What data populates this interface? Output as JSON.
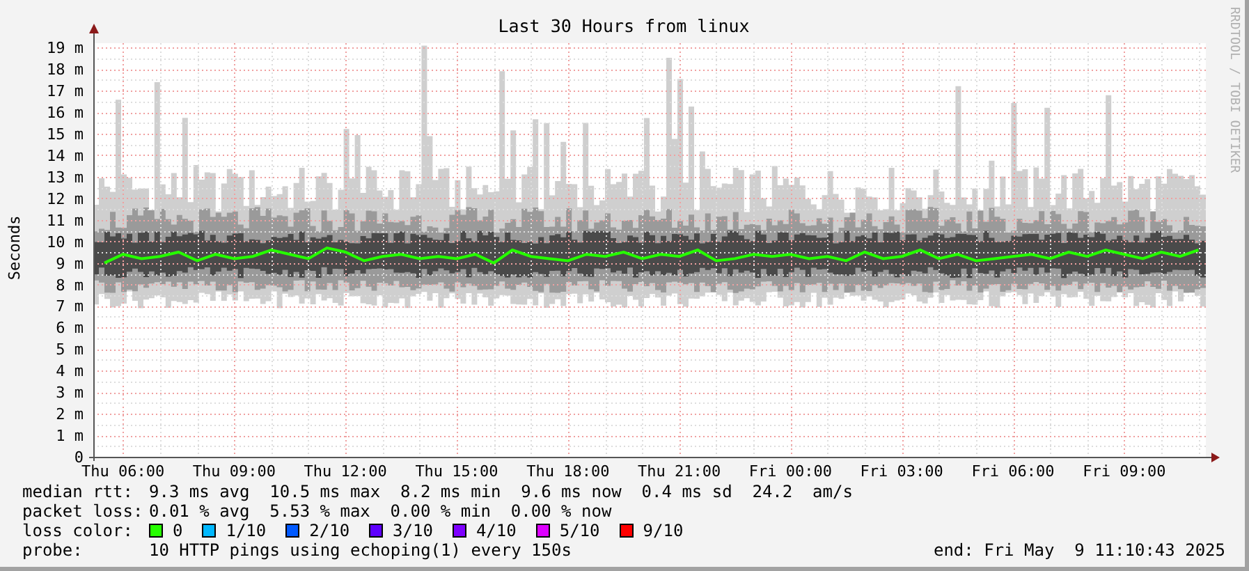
{
  "graph": {
    "credit": "RRDTOOL / TOBI OETIKER",
    "chart_data": {
      "type": "line",
      "grid": true,
      "title": "Last 30 Hours from linux",
      "ylabel": "Seconds",
      "ylim": [
        0,
        19.2
      ],
      "yticks": [
        {
          "value": 0,
          "label": "0"
        },
        {
          "value": 1,
          "label": "1 m"
        },
        {
          "value": 2,
          "label": "2 m"
        },
        {
          "value": 3,
          "label": "3 m"
        },
        {
          "value": 4,
          "label": "4 m"
        },
        {
          "value": 5,
          "label": "5 m"
        },
        {
          "value": 6,
          "label": "6 m"
        },
        {
          "value": 7,
          "label": "7 m"
        },
        {
          "value": 8,
          "label": "8 m"
        },
        {
          "value": 9,
          "label": "9 m"
        },
        {
          "value": 10,
          "label": "10 m"
        },
        {
          "value": 11,
          "label": "11 m"
        },
        {
          "value": 12,
          "label": "12 m"
        },
        {
          "value": 13,
          "label": "13 m"
        },
        {
          "value": 14,
          "label": "14 m"
        },
        {
          "value": 15,
          "label": "15 m"
        },
        {
          "value": 16,
          "label": "16 m"
        },
        {
          "value": 17,
          "label": "17 m"
        },
        {
          "value": 18,
          "label": "18 m"
        },
        {
          "value": 19,
          "label": "19 m"
        }
      ],
      "categories": [
        null,
        "Thu 06:00",
        null,
        null,
        null,
        null,
        null,
        "Thu 09:00",
        null,
        null,
        null,
        null,
        null,
        "Thu 12:00",
        null,
        null,
        null,
        null,
        null,
        "Thu 15:00",
        null,
        null,
        null,
        null,
        null,
        "Thu 18:00",
        null,
        null,
        null,
        null,
        null,
        "Thu 21:00",
        null,
        null,
        null,
        null,
        null,
        "Fri 00:00",
        null,
        null,
        null,
        null,
        null,
        "Fri 03:00",
        null,
        null,
        null,
        null,
        null,
        "Fri 06:00",
        null,
        null,
        null,
        null,
        null,
        "Fri 09:00",
        null,
        null,
        null,
        null
      ],
      "series": [
        {
          "color": "#26ff00",
          "values": [
            9.0,
            9.4,
            9.2,
            9.3,
            9.5,
            9.1,
            9.4,
            9.2,
            9.3,
            9.6,
            9.4,
            9.2,
            9.7,
            9.5,
            9.1,
            9.3,
            9.4,
            9.2,
            9.3,
            9.2,
            9.4,
            9.0,
            9.6,
            9.3,
            9.2,
            9.1,
            9.4,
            9.3,
            9.5,
            9.2,
            9.4,
            9.3,
            9.6,
            9.1,
            9.2,
            9.4,
            9.3,
            9.4,
            9.2,
            9.3,
            9.1,
            9.5,
            9.2,
            9.3,
            9.6,
            9.2,
            9.4,
            9.1,
            9.2,
            9.3,
            9.4,
            9.2,
            9.5,
            9.3,
            9.6,
            9.4,
            9.2,
            9.5,
            9.3,
            9.6
          ]
        }
      ]
    }
  },
  "stats": [
    {
      "label": "median rtt:",
      "values": [
        "9.3 ms avg",
        "10.5 ms max",
        "8.2 ms min",
        "9.6 ms now",
        "0.4 ms sd",
        "24.2",
        "am/s"
      ]
    },
    {
      "label": "packet loss:",
      "values": [
        "0.01 % avg",
        "5.53 % max",
        "0.00 % min",
        "0.00 % now"
      ]
    }
  ],
  "loss_colors": {
    "label": "loss color:",
    "items": [
      {
        "label": "0",
        "color": "#26ff00"
      },
      {
        "label": "1/10",
        "color": "#00b8ff"
      },
      {
        "label": "2/10",
        "color": "#0059ff"
      },
      {
        "label": "3/10",
        "color": "#5e00ff"
      },
      {
        "label": "4/10",
        "color": "#7e00ff"
      },
      {
        "label": "5/10",
        "color": "#dd00ff"
      },
      {
        "label": "9/10",
        "color": "#ff0000"
      }
    ]
  },
  "probe": {
    "label": "probe:",
    "text": "10 HTTP pings using echoping(1) every 150s"
  },
  "end": "end: Fri May  9 11:10:43 2025"
}
